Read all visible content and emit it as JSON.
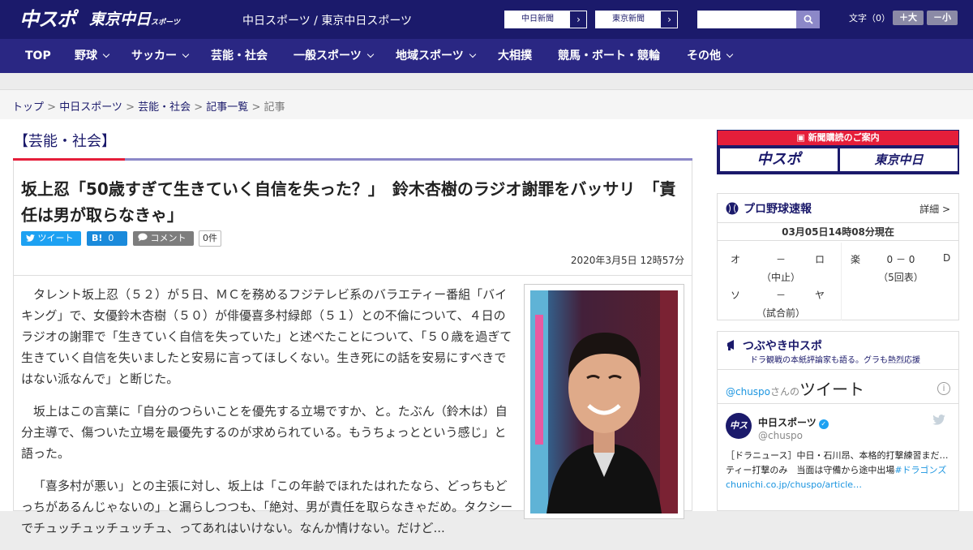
{
  "header": {
    "logo_main": "中スポ",
    "logo_tokyo": "東京中日",
    "logo_tokyo_sub": "スポーツ",
    "site_title": "中日スポーツ / 東京中日スポーツ",
    "newspaper_buttons": [
      "中日新聞",
      "東京新聞"
    ],
    "search_placeholder": "",
    "font_size_label": "文字（0）",
    "font_bigger": "＋大",
    "font_smaller": "－小"
  },
  "nav": [
    {
      "label": "TOP",
      "dropdown": false
    },
    {
      "label": "野球",
      "dropdown": true
    },
    {
      "label": "サッカー",
      "dropdown": true
    },
    {
      "label": "芸能・社会",
      "dropdown": false
    },
    {
      "label": "一般スポーツ",
      "dropdown": true
    },
    {
      "label": "地域スポーツ",
      "dropdown": true
    },
    {
      "label": "大相撲",
      "dropdown": false
    },
    {
      "label": "競馬・ボート・競輪",
      "dropdown": false
    },
    {
      "label": "その他",
      "dropdown": true
    }
  ],
  "breadcrumb": [
    "トップ",
    "中日スポーツ",
    "芸能・社会",
    "記事一覧",
    "記事"
  ],
  "article": {
    "category": "【芸能・社会】",
    "headline": "坂上忍「50歳すぎて生きていく自信を失った？」　鈴木杏樹のラジオ謝罪をバッサリ　「責任は男が取らなきゃ」",
    "tweet_label": "ツイート",
    "hatena_label": "B!",
    "hatena_count": "0",
    "comment_label": "コメント",
    "comment_count": "0件",
    "date": "2020年3月5日 12時57分",
    "paragraphs": [
      "タレント坂上忍（５２）が５日、ＭＣを務めるフジテレビ系のバラエティー番組「バイキング」で、女優鈴木杏樹（５０）が俳優喜多村緑郎（５１）との不倫について、４日のラジオの謝罪で「生きていく自信を失っていた」と述べたことについて、「５０歳を過ぎて生きていく自信を失いましたと安易に言ってほしくない。生き死にの話を安易にすべきではない派なんで」と断じた。",
      "坂上はこの言葉に「自分のつらいことを優先する立場ですか、と。たぶん（鈴木は）自分主導で、傷ついた立場を最優先するのが求められている。もうちょっとという感じ」と語った。",
      "「喜多村が悪い」との主張に対し、坂上は「この年齢でほれたはれたなら、どっちもどっちがあるんじゃないの」と漏らしつつも、「絶対、男が責任を取らなきゃだめ。タクシーでチュッチュッチュッチュ、ってあれはいけない。なんか情けない。だけど..."
    ]
  },
  "sidebar": {
    "promo_title": "新聞購読のご案内",
    "promo_logo1": "中スポ",
    "promo_logo2": "東京中日",
    "baseball_title": "プロ野球速報",
    "baseball_more": "詳細 >",
    "baseball_time": "03月05日14時08分現在",
    "games": [
      {
        "home": "オ",
        "score": "－",
        "away": "ロ",
        "status": "（中止）"
      },
      {
        "home": "楽",
        "score": "0 － 0",
        "away": "D",
        "status": "（5回表）"
      },
      {
        "home": "ソ",
        "score": "－",
        "away": "ヤ",
        "status": "（試合前）"
      }
    ],
    "twitter_title": "つぶやき中スポ",
    "twitter_sub": "ドラ観戦の本紙評論家も語る。グラも熱烈応援",
    "twitter_handle": "@chuspo",
    "twitter_handle_suffix": "さんの",
    "twitter_tweets_word": "ツイート",
    "tweet_author": "中日スポーツ",
    "tweet_user": "@chuspo",
    "tweet_avatar_text": "中スポ",
    "tweet_text": "［ドラニュース］中日・石川昂、本格的打撃練習まだ…ティー打撃のみ　当面は守備から途中出場",
    "tweet_link": "#ドラゴンズchunichi.co.jp/chuspo/article…"
  },
  "colors": {
    "navy": "#1b1a6b",
    "nav": "#2a2783",
    "accent_red": "#e51e3a"
  }
}
